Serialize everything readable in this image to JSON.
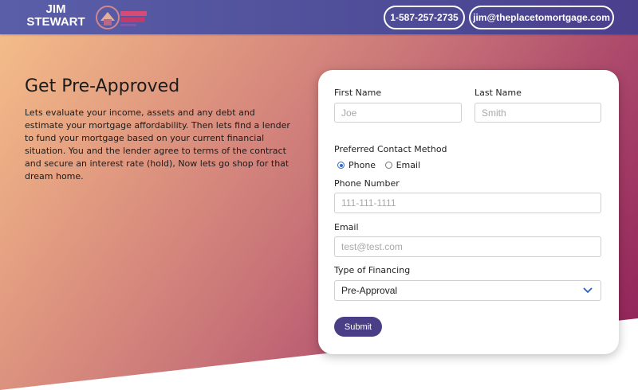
{
  "header": {
    "brand_line1": "JIM",
    "brand_line2": "STEWART",
    "logo_text": "THE PLACE TO MORTGAGE",
    "phone_label": "1-587-257-2735",
    "email_label": "jim@theplacetomortgage.com",
    "bg_color": "#4f4d98"
  },
  "hero": {
    "title": "Get Pre-Approved",
    "body": "Lets evaluate your income, assets and any debt and estimate your mortgage affordability. Then lets find a lender to fund your mortgage based on your current financial situation. You and the lender agree to terms of the contract and secure an interest rate (hold), Now lets go shop for that dream home."
  },
  "form": {
    "first_name_label": "First Name",
    "first_name_placeholder": "Joe",
    "last_name_label": "Last Name",
    "last_name_placeholder": "Smith",
    "contact_method_label": "Preferred Contact Method",
    "contact_options": [
      "Phone",
      "Email"
    ],
    "contact_selected": "Phone",
    "phone_label": "Phone Number",
    "phone_placeholder": "111-111-1111",
    "email_label": "Email",
    "email_placeholder": "test@test.com",
    "financing_label": "Type of Financing",
    "financing_selected": "Pre-Approval",
    "submit_label": "Submit",
    "submit_color": "#4a3f86"
  },
  "icons": {
    "radio_selected": "radio-selected-icon",
    "radio_unselected": "radio-unselected-icon",
    "select_arrow": "chevron-down-icon"
  }
}
